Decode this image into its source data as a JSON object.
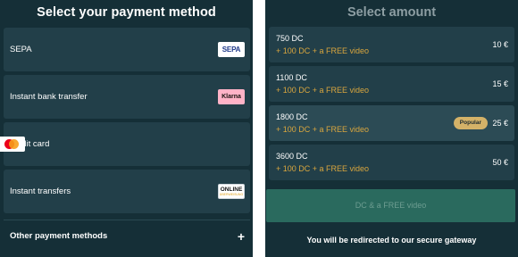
{
  "left": {
    "title": "Select your payment method",
    "methods": [
      {
        "label": "SEPA",
        "logo": "sepa-logo",
        "logo_text": "SEPA"
      },
      {
        "label": "Instant bank transfer",
        "logo": "klarna-logo",
        "logo_text": "Klarna"
      },
      {
        "label": "credit card",
        "logo": "mastercard-logo"
      },
      {
        "label": "Instant transfers",
        "logo": "online-banking-logo",
        "logo_text": "ONLINE",
        "logo_subtext": "ÜBERWEISUNG"
      }
    ],
    "other": {
      "label": "Other payment methods",
      "icon": "plus-icon",
      "glyph": "+"
    }
  },
  "right": {
    "title": "Select amount",
    "packages": [
      {
        "amount": "750 DC",
        "bonus": "+ 100 DC + a FREE video",
        "price": "10 €"
      },
      {
        "amount": "1100 DC",
        "bonus": "+ 100 DC + a FREE video",
        "price": "15 €"
      },
      {
        "amount": "1800 DC",
        "bonus": "+ 100 DC + a FREE video",
        "price": "25 €",
        "badge": "Popular"
      },
      {
        "amount": "3600 DC",
        "bonus": "+ 100 DC + a FREE video",
        "price": "50 €"
      }
    ],
    "cta_label": "DC & a FREE video",
    "redirect_note": "You will be redirected to our secure gateway"
  },
  "colors": {
    "background": "#152f37",
    "card": "#223f49",
    "bonus_text": "#d9a63e",
    "badge": "#d4b268",
    "cta": "#2a6a5e"
  }
}
